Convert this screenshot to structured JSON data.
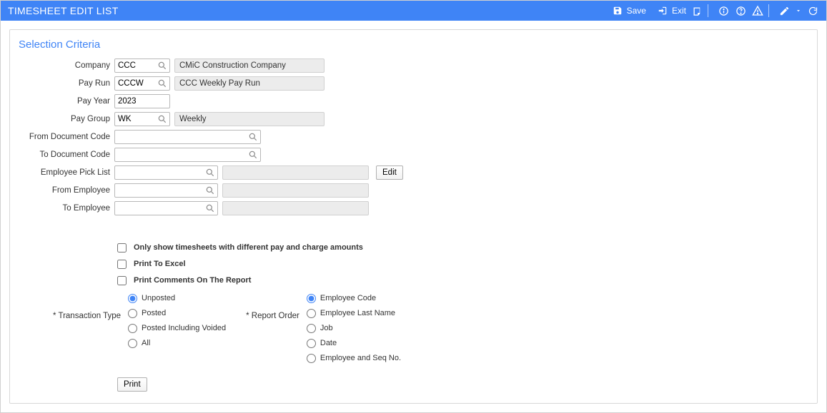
{
  "titlebar": {
    "title": "TIMESHEET EDIT LIST",
    "save_label": "Save",
    "exit_label": "Exit"
  },
  "section": {
    "title": "Selection Criteria"
  },
  "labels": {
    "company": "Company",
    "pay_run": "Pay Run",
    "pay_year": "Pay Year",
    "pay_group": "Pay Group",
    "from_doc": "From Document Code",
    "to_doc": "To Document Code",
    "emp_pick": "Employee Pick List",
    "from_emp": "From Employee",
    "to_emp": "To Employee",
    "transaction_type": "Transaction Type",
    "report_order": "Report Order"
  },
  "fields": {
    "company": {
      "value": "CCC",
      "desc": "CMiC Construction Company"
    },
    "pay_run": {
      "value": "CCCW",
      "desc": "CCC Weekly Pay Run"
    },
    "pay_year": {
      "value": "2023"
    },
    "pay_group": {
      "value": "WK",
      "desc": "Weekly"
    },
    "from_doc": {
      "value": ""
    },
    "to_doc": {
      "value": ""
    },
    "emp_pick": {
      "value": "",
      "desc": ""
    },
    "from_emp": {
      "value": "",
      "desc": ""
    },
    "to_emp": {
      "value": "",
      "desc": ""
    }
  },
  "buttons": {
    "edit": "Edit",
    "print": "Print"
  },
  "checkboxes": {
    "diff_amounts": "Only show timesheets with different pay and charge amounts",
    "print_excel": "Print To Excel",
    "print_comments": "Print Comments On The Report"
  },
  "transaction_type_options": [
    "Unposted",
    "Posted",
    "Posted Including Voided",
    "All"
  ],
  "report_order_options": [
    "Employee Code",
    "Employee Last Name",
    "Job",
    "Date",
    "Employee and Seq No."
  ]
}
